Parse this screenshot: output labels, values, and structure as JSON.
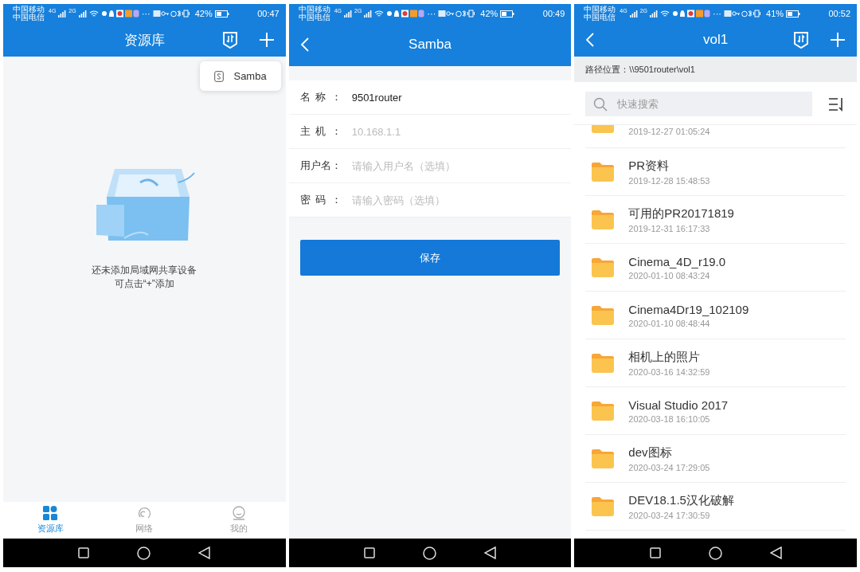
{
  "screens": [
    {
      "kind": "library",
      "status_bar": {
        "carriers": [
          "中国移动",
          "中国电信"
        ],
        "networks": [
          "4G",
          "2G"
        ],
        "overflow": "···",
        "battery": "42%",
        "time": "00:47"
      },
      "app_bar": {
        "title": "资源库",
        "back": false,
        "actions": true
      },
      "popup_menu": [
        {
          "label": "Samba"
        }
      ],
      "empty_state": [
        "还未添加局域网共享设备",
        "可点击“+”添加"
      ],
      "bottom_tabs": [
        {
          "label": "资源库",
          "selected": true
        },
        {
          "label": "网络",
          "selected": false
        },
        {
          "label": "我的",
          "selected": false
        }
      ]
    },
    {
      "kind": "form",
      "status_bar": {
        "carriers": [
          "中国移动",
          "中国电信"
        ],
        "networks": [
          "4G",
          "2G"
        ],
        "overflow": "···",
        "battery": "42%",
        "time": "00:49"
      },
      "app_bar": {
        "title": "Samba",
        "back": true,
        "actions": false
      },
      "fields": [
        {
          "label": "名称：",
          "value": "9501router"
        },
        {
          "label": "主机：",
          "placeholder": "10.168.1.1"
        },
        {
          "label": "用户名：",
          "placeholder": "请输入用户名（选填）"
        },
        {
          "label": "密码：",
          "placeholder": "请输入密码（选填）"
        }
      ],
      "save_button": "保存"
    },
    {
      "kind": "browser",
      "status_bar": {
        "carriers": [
          "中国移动",
          "中国电信"
        ],
        "networks": [
          "4G",
          "2G"
        ],
        "overflow": "···",
        "battery": "41%",
        "time": "00:52"
      },
      "app_bar": {
        "title": "vol1",
        "back": true,
        "actions": true
      },
      "path": "路径位置：\\\\9501router\\vol1",
      "search": {
        "placeholder": "快速搜索"
      },
      "files": [
        {
          "date": "2019-12-27 01:05:24"
        },
        {
          "name": "PR资料",
          "date": "2019-12-28 15:48:53"
        },
        {
          "name": "可用的PR20171819",
          "date": "2019-12-31 16:17:33"
        },
        {
          "name": "Cinema_4D_r19.0",
          "date": "2020-01-10 08:43:24"
        },
        {
          "name": "Cinema4Dr19_102109",
          "date": "2020-01-10 08:48:44"
        },
        {
          "name": "相机上的照片",
          "date": "2020-03-16 14:32:59"
        },
        {
          "name": "Visual Studio 2017",
          "date": "2020-03-18 16:10:05"
        },
        {
          "name": "dev图标",
          "date": "2020-03-24 17:29:05"
        },
        {
          "name": "DEV18.1.5汉化破解",
          "date": "2020-03-24 17:30:59"
        }
      ]
    }
  ]
}
